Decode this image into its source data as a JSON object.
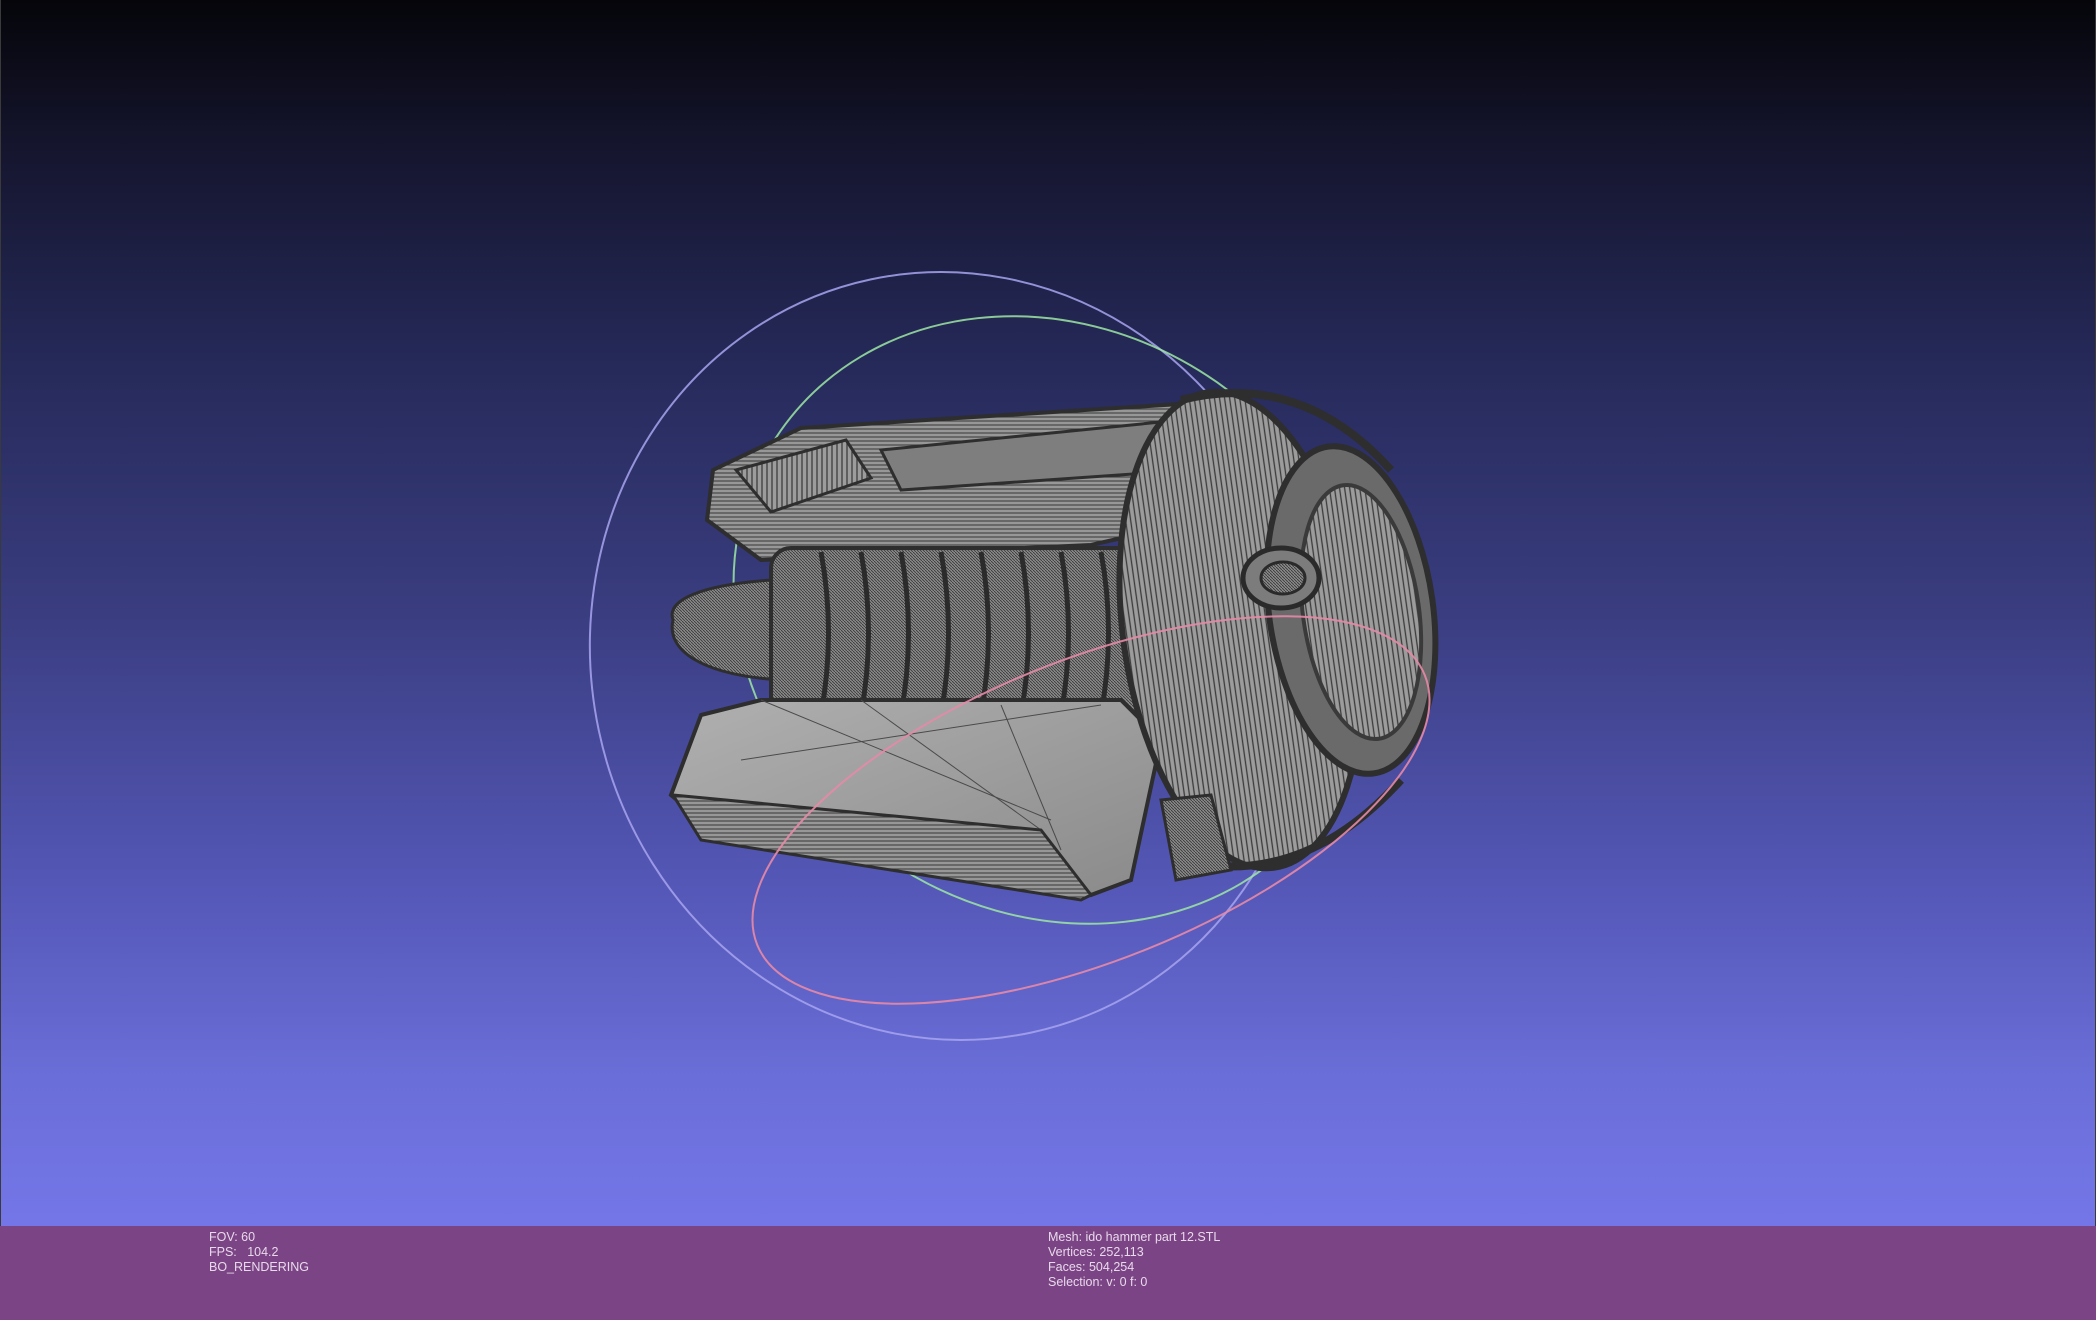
{
  "viewport": {
    "background_top": "#05050a",
    "background_bottom": "#7476e8",
    "model_color": "#9a9a9a",
    "wire_color": "#3c3c3c",
    "trackball_colors": {
      "x_ring": "#e88aa6",
      "y_ring": "#9ee8a4",
      "z_ring": "#a8a4f0"
    }
  },
  "status": {
    "fov": "FOV: 60",
    "fps": "FPS:   104.2",
    "render_mode": "BO_RENDERING",
    "mesh": "Mesh: ido hammer part 12.STL",
    "vertices": "Vertices: 252,113",
    "faces": "Faces: 504,254",
    "selection": "Selection: v: 0 f: 0"
  },
  "colors": {
    "statusbar_bg": "#7b4585",
    "statusbar_text": "#e9d9ec"
  }
}
